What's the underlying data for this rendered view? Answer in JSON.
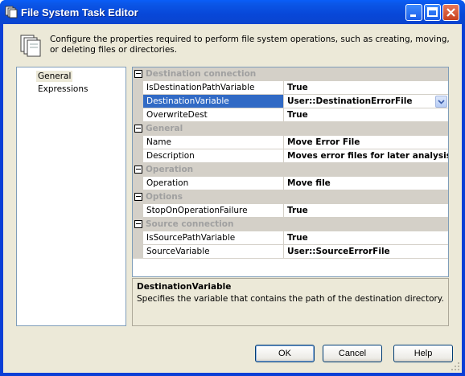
{
  "window": {
    "title": "File System Task Editor",
    "controls": {
      "minimize": "minimize",
      "maximize": "maximize",
      "close": "close"
    }
  },
  "header": {
    "description": "Configure the properties required to perform file system operations, such as creating, moving, or deleting files or directories."
  },
  "nav": {
    "items": [
      {
        "label": "General",
        "selected": true
      },
      {
        "label": "Expressions",
        "selected": false
      }
    ]
  },
  "grid": {
    "categories": [
      {
        "label": "Destination connection",
        "properties": [
          {
            "name": "IsDestinationPathVariable",
            "value": "True"
          },
          {
            "name": "DestinationVariable",
            "value": "User::DestinationErrorFile"
          },
          {
            "name": "OverwriteDest",
            "value": "True"
          }
        ]
      },
      {
        "label": "General",
        "properties": [
          {
            "name": "Name",
            "value": "Move Error File"
          },
          {
            "name": "Description",
            "value": "Moves error files for later analysis."
          }
        ]
      },
      {
        "label": "Operation",
        "properties": [
          {
            "name": "Operation",
            "value": "Move file"
          }
        ]
      },
      {
        "label": "Options",
        "properties": [
          {
            "name": "StopOnOperationFailure",
            "value": "True"
          }
        ]
      },
      {
        "label": "Source connection",
        "properties": [
          {
            "name": "IsSourcePathVariable",
            "value": "True"
          },
          {
            "name": "SourceVariable",
            "value": "User::SourceErrorFile"
          }
        ]
      }
    ]
  },
  "description_panel": {
    "title": "DestinationVariable",
    "text": "Specifies the variable that contains the path of the destination directory."
  },
  "buttons": {
    "ok": "OK",
    "cancel": "Cancel",
    "help": "Help"
  },
  "colors": {
    "titlebar": "#0a4ee0",
    "selection": "#316ac5",
    "dialog_bg": "#ece9d8"
  }
}
